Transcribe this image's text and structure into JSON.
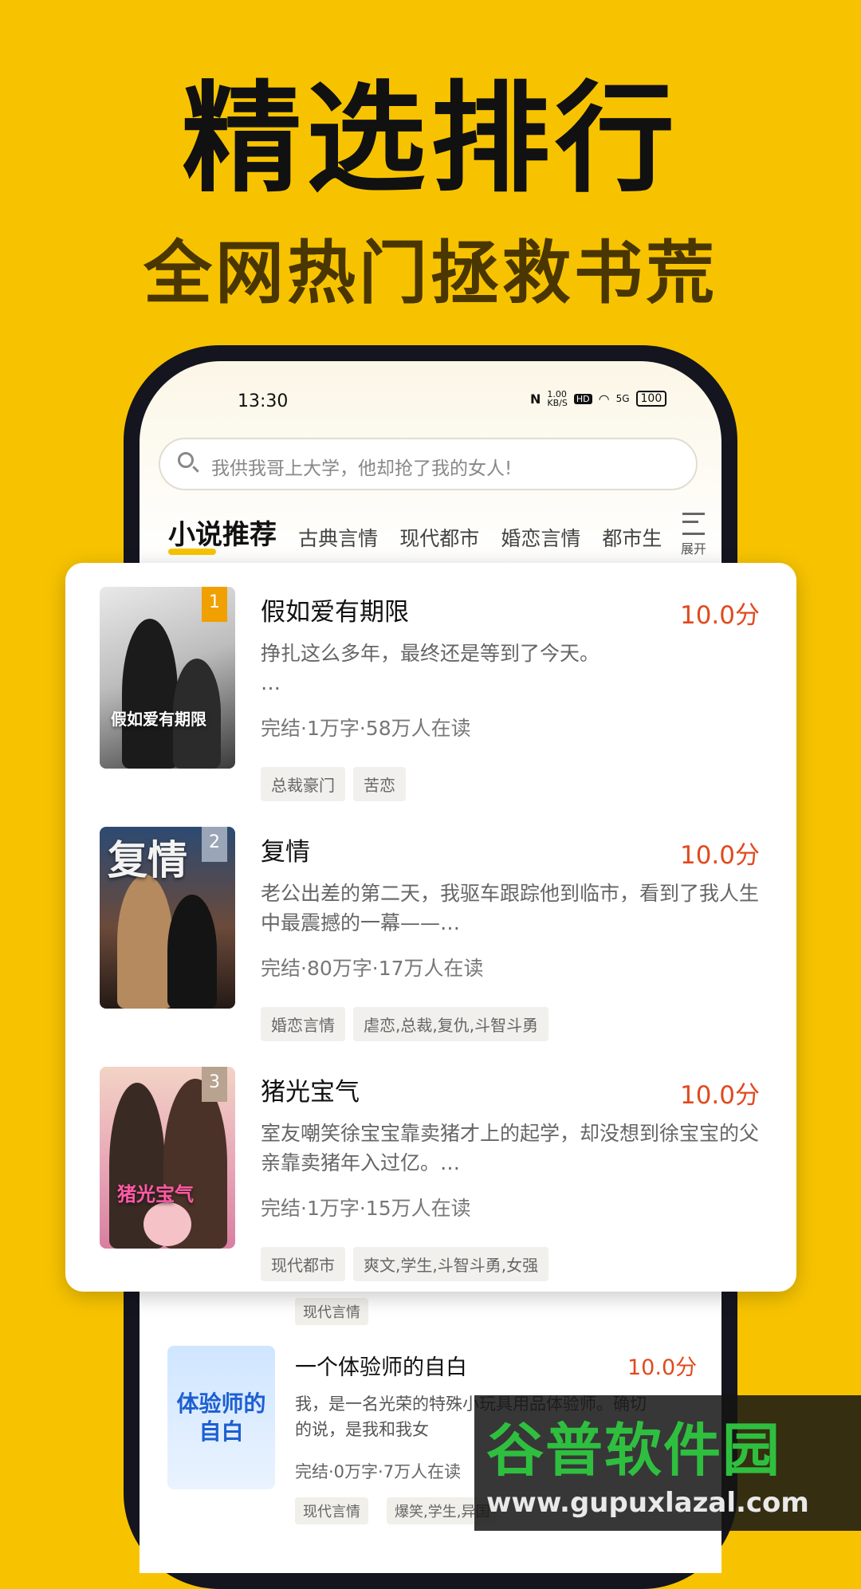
{
  "headline": "精选排行",
  "subline": "全网热门拯救书荒",
  "phone": {
    "status": {
      "time": "13:30",
      "speed": "1.00\nKB/S",
      "hd": "HD",
      "net": "5G",
      "battery": "100"
    },
    "search": {
      "placeholder": "我供我哥上大学，他却抢了我的女人!"
    },
    "tabs": [
      {
        "label": "小说推荐"
      },
      {
        "label": "古典言情"
      },
      {
        "label": "现代都市"
      },
      {
        "label": "婚恋言情"
      },
      {
        "label": "都市生"
      }
    ],
    "expand_label": "展开",
    "peek_tag": "现代言情",
    "lower_item": {
      "cover_text": "体验师的自白",
      "title": "一个体验师的自白",
      "score": "10.0分",
      "desc": "我，是一名光荣的特殊小玩具用品体验师。确切的说，是我和我女",
      "meta": "完结·0万字·7万人在读",
      "tags": [
        "现代言情",
        "爆笑,学生,异国"
      ]
    }
  },
  "ranking": [
    {
      "rank": "1",
      "cover_text": "假如爱有期限",
      "title": "假如爱有期限",
      "score": "10.0分",
      "desc": "挣扎这么多年，最终还是等到了今天。\n…",
      "meta": "完结·1万字·58万人在读",
      "tags": [
        "总裁豪门",
        "苦恋"
      ],
      "rank_color": "#F0A000"
    },
    {
      "rank": "2",
      "cover_text": "复情",
      "title": "复情",
      "score": "10.0分",
      "desc": "老公出差的第二天，我驱车跟踪他到临市，看到了我人生中最震撼的一幕——…",
      "meta": "完结·80万字·17万人在读",
      "tags": [
        "婚恋言情",
        "虐恋,总裁,复仇,斗智斗勇"
      ],
      "rank_color": "#9aa6b8"
    },
    {
      "rank": "3",
      "cover_text": "猪光宝气",
      "title": "猪光宝气",
      "score": "10.0分",
      "desc": "室友嘲笑徐宝宝靠卖猪才上的起学，却没想到徐宝宝的父亲靠卖猪年入过亿。…",
      "meta": "完结·1万字·15万人在读",
      "tags": [
        "现代都市",
        "爽文,学生,斗智斗勇,女强"
      ],
      "rank_color": "#b7a38f"
    }
  ],
  "watermark": {
    "brand": "谷普软件园",
    "url": "www.gupuxlazal.com"
  },
  "colors": {
    "background": "#F7C300",
    "score": "#e04a1e",
    "watermark_green": "#2fbf3f"
  }
}
